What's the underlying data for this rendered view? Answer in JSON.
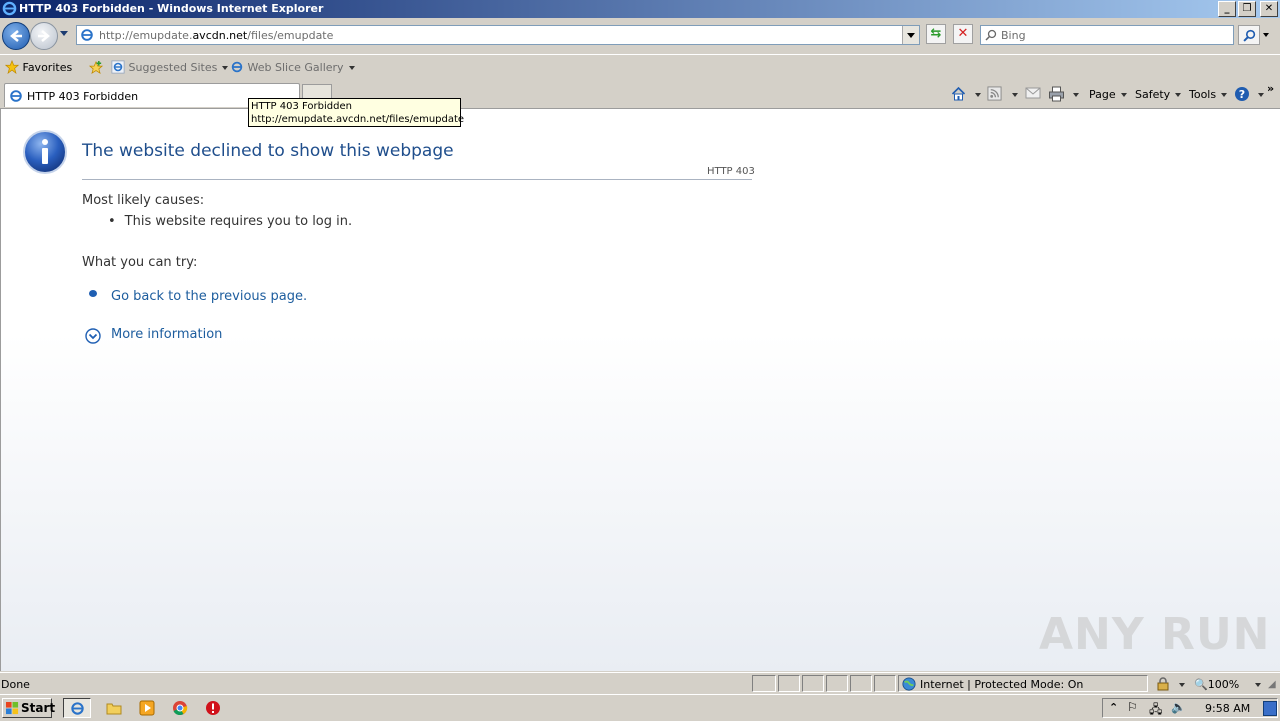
{
  "window": {
    "title": "HTTP 403 Forbidden - Windows Internet Explorer"
  },
  "navbar": {
    "address": {
      "prefix": "http://emupdate.",
      "domain": "avcdn.net",
      "suffix": "/files/emupdate"
    },
    "search_placeholder": "Bing"
  },
  "favbar": {
    "favorites": "Favorites",
    "suggested": "Suggested Sites",
    "webslice": "Web Slice Gallery"
  },
  "tabs": [
    {
      "label": "HTTP 403 Forbidden"
    }
  ],
  "commandbar": {
    "page": "Page",
    "safety": "Safety",
    "tools": "Tools"
  },
  "tooltip": {
    "line1": "HTTP 403 Forbidden",
    "line2": "http://emupdate.avcdn.net/files/emupdate"
  },
  "content": {
    "heading": "The website declined to show this webpage",
    "code": "HTTP 403",
    "causes_heading": "Most likely causes:",
    "causes": [
      "This website requires you to log in."
    ],
    "try_heading": "What you can try:",
    "go_back": "Go back to the previous page.",
    "more_info": "More information"
  },
  "watermark": "ANY RUN",
  "statusbar": {
    "status": "Done",
    "zone": "Internet | Protected Mode: On",
    "zoom": "100%"
  },
  "taskbar": {
    "start": "Start",
    "clock": "9:58 AM"
  },
  "colors": {
    "link": "#1d5d9e",
    "heading": "#1f4e8c",
    "titlebar_start": "#0a246a",
    "titlebar_end": "#a6caf0"
  }
}
